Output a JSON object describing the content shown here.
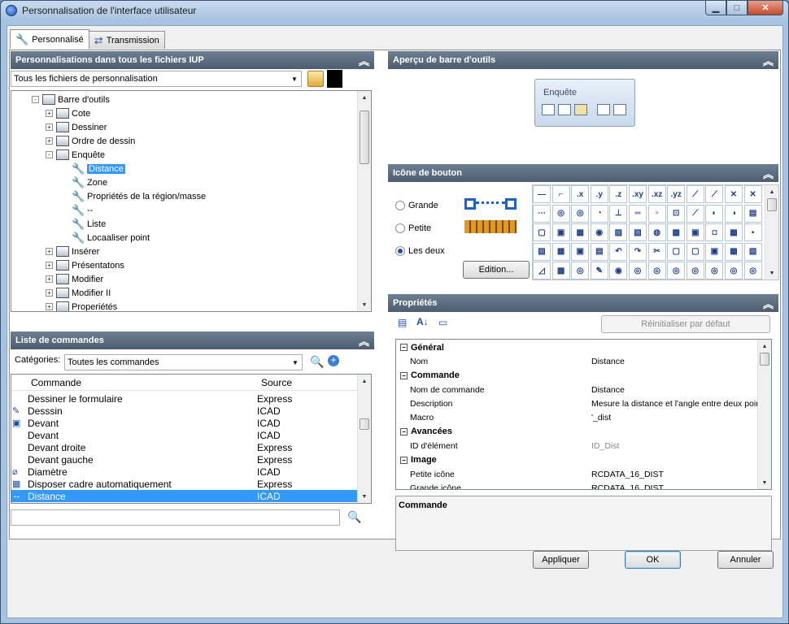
{
  "window": {
    "title": "Personnalisation de l'interface utilisateur"
  },
  "tabs": [
    {
      "label": "Personnalisé"
    },
    {
      "label": "Transmission"
    }
  ],
  "customizations_panel": {
    "header": "Personnalisations dans tous les fichiers IUP",
    "file_combo": "Tous les fichiers de personnalisation",
    "tree": [
      {
        "label": "Barre d'outils",
        "level": 0,
        "expander": "-"
      },
      {
        "label": "Cote",
        "level": 1,
        "expander": "+"
      },
      {
        "label": "Dessiner",
        "level": 1,
        "expander": "+"
      },
      {
        "label": "Ordre de dessin",
        "level": 1,
        "expander": "+"
      },
      {
        "label": "Enquête",
        "level": 1,
        "expander": "-"
      },
      {
        "label": "Distance",
        "level": 2,
        "selected": true
      },
      {
        "label": "Zone",
        "level": 2
      },
      {
        "label": "Propriétés de la région/masse",
        "level": 2
      },
      {
        "label": "--",
        "level": 2
      },
      {
        "label": "Liste",
        "level": 2
      },
      {
        "label": "Locaaliser point",
        "level": 2
      },
      {
        "label": "Insérer",
        "level": 1,
        "expander": "+"
      },
      {
        "label": "Présentatons",
        "level": 1,
        "expander": "+"
      },
      {
        "label": "Modifier",
        "level": 1,
        "expander": "+"
      },
      {
        "label": "Modifier II",
        "level": 1,
        "expander": "+"
      },
      {
        "label": "Properiétés",
        "level": 1,
        "expander": "+"
      }
    ]
  },
  "commands_panel": {
    "header": "Liste de commandes",
    "categories_label": "Catégories:",
    "categories_value": "Toutes les commandes",
    "col_command": "Commande",
    "col_source": "Source",
    "rows": [
      {
        "command": "Dessiner le formulaire",
        "source": "Express",
        "icon": ""
      },
      {
        "command": "Desssin",
        "source": "ICAD",
        "icon": "drawing-icon"
      },
      {
        "command": "Devant",
        "source": "ICAD",
        "icon": "view-front-icon"
      },
      {
        "command": "Devant",
        "source": "ICAD",
        "icon": ""
      },
      {
        "command": "Devant droite",
        "source": "Express",
        "icon": ""
      },
      {
        "command": "Devant gauche",
        "source": "Express",
        "icon": ""
      },
      {
        "command": "Diamètre",
        "source": "ICAD",
        "icon": "diameter-icon"
      },
      {
        "command": "Disposer cadre automatiquement",
        "source": "Express",
        "icon": "frame-icon"
      },
      {
        "command": "Distance",
        "source": "ICAD",
        "icon": "distance-icon",
        "selected": true
      }
    ],
    "search_value": ""
  },
  "toolbar_preview": {
    "header": "Aperçu de barre d'outils",
    "toolbar_title": "Enquête"
  },
  "button_icon": {
    "header": "Icône de bouton",
    "options": [
      {
        "label": "Grande",
        "checked": false
      },
      {
        "label": "Petite",
        "checked": false
      },
      {
        "label": "Les deux",
        "checked": true
      }
    ],
    "edit_label": "Edition...",
    "grid_labels": [
      ".x",
      ".y",
      ".z",
      ".xy",
      ".xz",
      ".yz"
    ]
  },
  "properties": {
    "header": "Propriétés",
    "reset_label": "Réinitialiser par défaut",
    "sections": [
      {
        "title": "Général",
        "rows": [
          {
            "name": "Nom",
            "value": "Distance"
          }
        ]
      },
      {
        "title": "Commande",
        "rows": [
          {
            "name": "Nom de commande",
            "value": "Distance"
          },
          {
            "name": "Description",
            "value": "Mesure la distance et l'angle entre deux point"
          },
          {
            "name": "Macro",
            "value": "'_dist"
          }
        ]
      },
      {
        "title": "Avancées",
        "rows": [
          {
            "name": "ID d'élément",
            "value": "ID_Dist",
            "grey": true
          }
        ]
      },
      {
        "title": "Image",
        "rows": [
          {
            "name": "Petite icône",
            "value": "RCDATA_16_DIST"
          },
          {
            "name": "Grande icône",
            "value": "RCDATA_16_DIST"
          }
        ]
      }
    ],
    "help_title": "Commande"
  },
  "footer": {
    "apply": "Appliquer",
    "ok": "OK",
    "cancel": "Annuler"
  }
}
